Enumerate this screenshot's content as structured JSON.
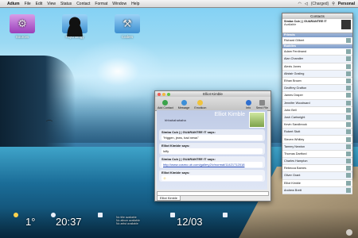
{
  "menubar": {
    "app": "Adium",
    "items": [
      "File",
      "Edit",
      "View",
      "Status",
      "Contact",
      "Format",
      "Window",
      "Help"
    ],
    "status": "(Charged)",
    "user": "Personal"
  },
  "desktop": {
    "icons": [
      {
        "label": "Sources",
        "icon": "gear-icon"
      },
      {
        "label": "Psychology",
        "icon": "head-icon"
      },
      {
        "label": "Coders",
        "icon": "tools-icon"
      }
    ]
  },
  "chat": {
    "title": "Elliot Kimble",
    "toolbar": [
      "Add Contact",
      "Message",
      "Emoticon",
      "Info",
      "Send File"
    ],
    "partner_name": "Elliot Kimble",
    "mood": "hhhahahahaha",
    "messages": [
      {
        "who": "Simba Cub | | GUARANTEE IT says:",
        "text": "\"friggen, jews, bad news\""
      },
      {
        "who": "Elliot Kimble says:",
        "text": "lolfy"
      },
      {
        "who": "Simba Cub | | GUARANTEE IT says:",
        "text": "http://www.cosmo.ub.com/gallery2/v/normal/11421712018"
      },
      {
        "who": "Elliot Kimble says:",
        "text": ""
      }
    ],
    "tab": "Elliot Kimble"
  },
  "contacts": {
    "title": "Contacts",
    "me": {
      "name": "Simba Cub | | GUARANTEE IT",
      "status": "Available"
    },
    "groups": [
      {
        "name": "Friends",
        "members": [
          "Richard Gilbert"
        ]
      },
      {
        "name": "Buddies",
        "members": [
          "Adam Ferdinand",
          "Alan Chandler",
          "Alexis Jones",
          "Alistair Gosling",
          "Ethan Brown",
          "Geoffrey Grafton",
          "James Draper",
          "Jennifer Woodward",
          "John Bell",
          "Josh Cartwright",
          "Kevin Sandbrook",
          "Robert Stott",
          "Steven Whitley",
          "Tammy Newton",
          "Thomas Dartford",
          "Charles Hampton",
          "Rebecca Barnes",
          "Oliver Grant",
          "Elliot Kimble",
          "Andrew Brett"
        ]
      }
    ]
  },
  "widgets": {
    "temperature": "1°",
    "time": "20:37",
    "mail_lines": [
      "No title available",
      "No album available",
      "No artist available"
    ],
    "date": "12/03"
  }
}
